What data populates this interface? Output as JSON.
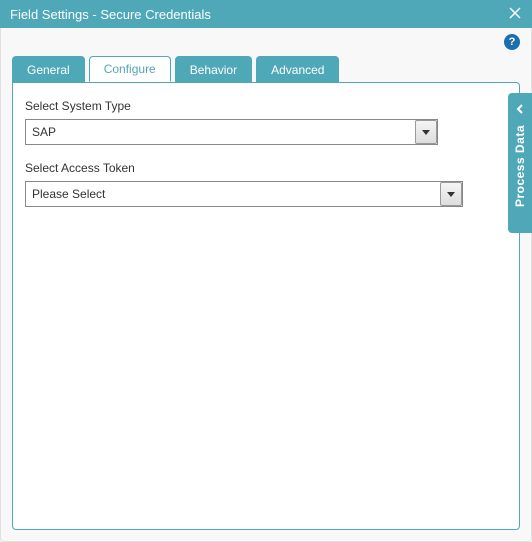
{
  "titlebar": {
    "title": "Field Settings - Secure Credentials"
  },
  "help": {
    "glyph": "?"
  },
  "tabs": {
    "general": "General",
    "configure": "Configure",
    "behavior": "Behavior",
    "advanced": "Advanced"
  },
  "fields": {
    "system_type": {
      "label": "Select System Type",
      "value": "SAP"
    },
    "access_token": {
      "label": "Select Access Token",
      "value": "Please Select"
    }
  },
  "side": {
    "label": "Process Data"
  }
}
